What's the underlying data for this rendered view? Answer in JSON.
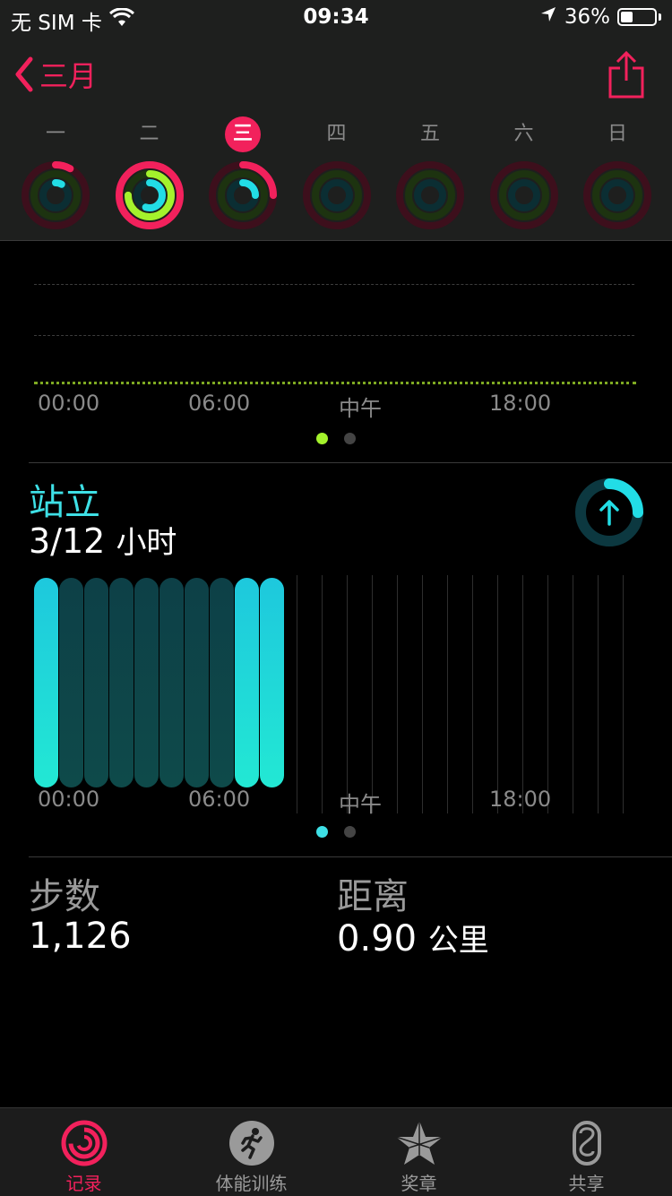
{
  "status_bar": {
    "carrier": "无 SIM 卡",
    "time": "09:34",
    "battery": "36%",
    "battery_level": 0.36,
    "icons": [
      "wifi-icon",
      "location-arrow-icon",
      "battery-icon"
    ]
  },
  "nav": {
    "back_label": "三月",
    "share_icon": "share-icon"
  },
  "colors": {
    "move": "#f2215c",
    "exercise": "#a4f22c",
    "stand": "#22dde6",
    "header_bg": "#1e1f1e"
  },
  "week": [
    {
      "label": "一",
      "today": false,
      "move": 0.08,
      "exercise": 0.0,
      "stand": 0.08
    },
    {
      "label": "二",
      "today": false,
      "move": 1.0,
      "exercise": 0.75,
      "stand": 0.55
    },
    {
      "label": "三",
      "today": true,
      "move": 0.25,
      "exercise": 0.0,
      "stand": 0.25
    },
    {
      "label": "四",
      "today": false,
      "move": 0,
      "exercise": 0,
      "stand": 0
    },
    {
      "label": "五",
      "today": false,
      "move": 0,
      "exercise": 0,
      "stand": 0
    },
    {
      "label": "六",
      "today": false,
      "move": 0,
      "exercise": 0,
      "stand": 0
    },
    {
      "label": "日",
      "today": false,
      "move": 0,
      "exercise": 0,
      "stand": 0
    }
  ],
  "exercise_chart": {
    "x_labels": [
      "00:00",
      "06:00",
      "中午",
      "18:00"
    ]
  },
  "stand": {
    "title": "站立",
    "value": "3/12",
    "unit": "小时",
    "progress": 0.25,
    "x_labels": [
      "00:00",
      "06:00",
      "中午",
      "18:00"
    ],
    "hours_active": [
      true,
      false,
      false,
      false,
      false,
      false,
      false,
      false,
      true,
      true
    ]
  },
  "stats": {
    "steps_label": "步数",
    "steps_value": "1,126",
    "distance_label": "距离",
    "distance_value": "0.90",
    "distance_unit": "公里"
  },
  "tabs": [
    {
      "label": "记录",
      "icon": "activity-rings-icon",
      "active": true
    },
    {
      "label": "体能训练",
      "icon": "running-figure-icon",
      "active": false
    },
    {
      "label": "奖章",
      "icon": "award-star-icon",
      "active": false
    },
    {
      "label": "共享",
      "icon": "sharing-icon",
      "active": false
    }
  ]
}
